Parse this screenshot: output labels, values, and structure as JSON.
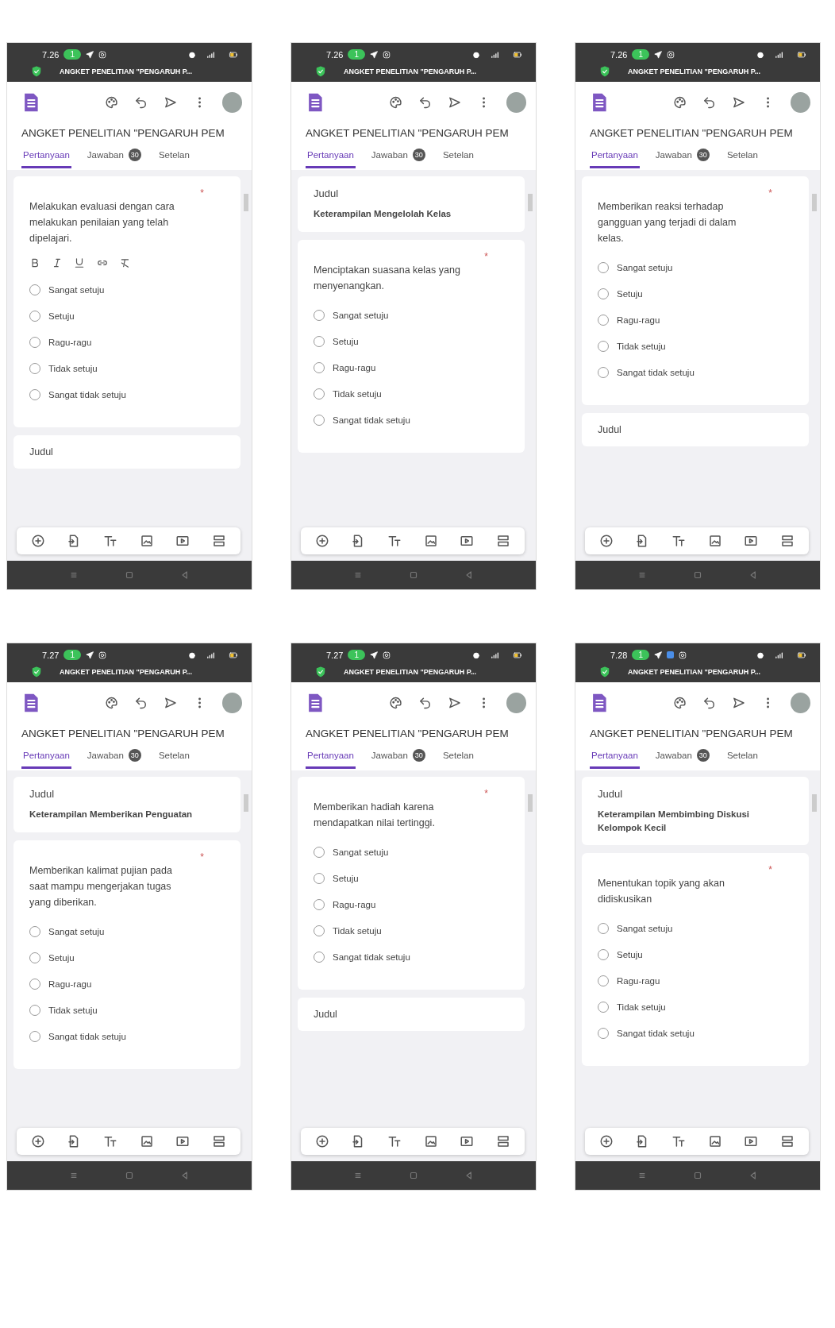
{
  "phones": [
    {
      "status": {
        "time": "7.26",
        "badge": "1",
        "extra_icon": false
      },
      "notification": "ANGKET PENELITIAN \"PENGARUH P...",
      "form_title": "ANGKET PENELITIAN \"PENGARUH PEM",
      "tabs": [
        {
          "label": "Pertanyaan",
          "selected": true
        },
        {
          "label": "Jawaban",
          "count": "30",
          "selected": false
        },
        {
          "label": "Setelan",
          "selected": false
        }
      ],
      "question": {
        "text": "Melakukan evaluasi dengan cara melakukan penilaian yang telah dipelajari.",
        "required_mark": "*",
        "formatting": true,
        "options": [
          {
            "label": "Sangat setuju",
            "selected": false
          },
          {
            "label": "Setuju",
            "selected": false
          },
          {
            "label": "Ragu-ragu",
            "selected": false
          },
          {
            "label": "Tidak setuju",
            "selected": false
          },
          {
            "label": "Sangat tidak setuju",
            "selected": false
          }
        ]
      },
      "next_card": "Judul"
    },
    {
      "status": {
        "time": "7.26",
        "badge": "1",
        "extra_icon": false
      },
      "notification": "ANGKET PENELITIAN \"PENGARUH P...",
      "form_title": "ANGKET PENELITIAN \"PENGARUH PEM",
      "tabs": [
        {
          "label": "Pertanyaan",
          "selected": true
        },
        {
          "label": "Jawaban",
          "count": "30",
          "selected": false
        },
        {
          "label": "Setelan",
          "selected": false
        }
      ],
      "section": {
        "label": "Judul",
        "title": "Keterampilan Mengelolah Kelas"
      },
      "question": {
        "text": "Menciptakan suasana kelas yang menyenangkan.",
        "required_mark": "*",
        "formatting": false,
        "options": [
          {
            "label": "Sangat setuju",
            "selected": false
          },
          {
            "label": "Setuju",
            "selected": false
          },
          {
            "label": "Ragu-ragu",
            "selected": false
          },
          {
            "label": "Tidak setuju",
            "selected": false
          },
          {
            "label": "Sangat tidak setuju",
            "selected": false
          }
        ]
      }
    },
    {
      "status": {
        "time": "7.26",
        "badge": "1",
        "extra_icon": false
      },
      "notification": "ANGKET PENELITIAN \"PENGARUH P...",
      "form_title": "ANGKET PENELITIAN \"PENGARUH PEM",
      "tabs": [
        {
          "label": "Pertanyaan",
          "selected": true
        },
        {
          "label": "Jawaban",
          "count": "30",
          "selected": false
        },
        {
          "label": "Setelan",
          "selected": false
        }
      ],
      "question": {
        "text": "Memberikan reaksi terhadap gangguan yang terjadi di dalam kelas.",
        "required_mark": "*",
        "formatting": false,
        "options": [
          {
            "label": "Sangat setuju",
            "selected": false
          },
          {
            "label": "Setuju",
            "selected": false
          },
          {
            "label": "Ragu-ragu",
            "selected": false
          },
          {
            "label": "Tidak setuju",
            "selected": false
          },
          {
            "label": "Sangat tidak setuju",
            "selected": false
          }
        ]
      },
      "next_card": "Judul"
    },
    {
      "status": {
        "time": "7.27",
        "badge": "1",
        "extra_icon": false
      },
      "notification": "ANGKET PENELITIAN \"PENGARUH P...",
      "form_title": "ANGKET PENELITIAN \"PENGARUH PEM",
      "tabs": [
        {
          "label": "Pertanyaan",
          "selected": true
        },
        {
          "label": "Jawaban",
          "count": "30",
          "selected": false
        },
        {
          "label": "Setelan",
          "selected": false
        }
      ],
      "section": {
        "label": "Judul",
        "title": "Keterampilan Memberikan Penguatan"
      },
      "question": {
        "text": "Memberikan kalimat pujian pada saat mampu mengerjakan tugas yang diberikan.",
        "required_mark": "*",
        "formatting": false,
        "options": [
          {
            "label": "Sangat setuju",
            "selected": false
          },
          {
            "label": "Setuju",
            "selected": false
          },
          {
            "label": "Ragu-ragu",
            "selected": false
          },
          {
            "label": "Tidak setuju",
            "selected": false
          },
          {
            "label": "Sangat tidak setuju",
            "selected": false
          }
        ]
      }
    },
    {
      "status": {
        "time": "7.27",
        "badge": "1",
        "extra_icon": false
      },
      "notification": "ANGKET PENELITIAN \"PENGARUH P...",
      "form_title": "ANGKET PENELITIAN \"PENGARUH PEM",
      "tabs": [
        {
          "label": "Pertanyaan",
          "selected": true
        },
        {
          "label": "Jawaban",
          "count": "30",
          "selected": false
        },
        {
          "label": "Setelan",
          "selected": false
        }
      ],
      "question": {
        "text": "Memberikan hadiah karena mendapatkan nilai tertinggi.",
        "required_mark": "*",
        "formatting": false,
        "options": [
          {
            "label": "Sangat setuju",
            "selected": false
          },
          {
            "label": "Setuju",
            "selected": false
          },
          {
            "label": "Ragu-ragu",
            "selected": false
          },
          {
            "label": "Tidak setuju",
            "selected": false
          },
          {
            "label": "Sangat tidak setuju",
            "selected": false
          }
        ]
      },
      "next_card": "Judul"
    },
    {
      "status": {
        "time": "7.28",
        "badge": "1",
        "extra_icon": true
      },
      "notification": "ANGKET PENELITIAN \"PENGARUH P...",
      "form_title": "ANGKET PENELITIAN \"PENGARUH PEM",
      "tabs": [
        {
          "label": "Pertanyaan",
          "selected": true
        },
        {
          "label": "Jawaban",
          "count": "30",
          "selected": false
        },
        {
          "label": "Setelan",
          "selected": false
        }
      ],
      "section": {
        "label": "Judul",
        "title": "Keterampilan Membimbing Diskusi Kelompok Kecil"
      },
      "question": {
        "text": "Menentukan topik yang akan didiskusikan",
        "required_mark": "*",
        "formatting": false,
        "options": [
          {
            "label": "Sangat setuju",
            "selected": false
          },
          {
            "label": "Setuju",
            "selected": false
          },
          {
            "label": "Ragu-ragu",
            "selected": false
          },
          {
            "label": "Tidak setuju",
            "selected": false
          },
          {
            "label": "Sangat tidak setuju",
            "selected": false
          }
        ]
      }
    }
  ]
}
